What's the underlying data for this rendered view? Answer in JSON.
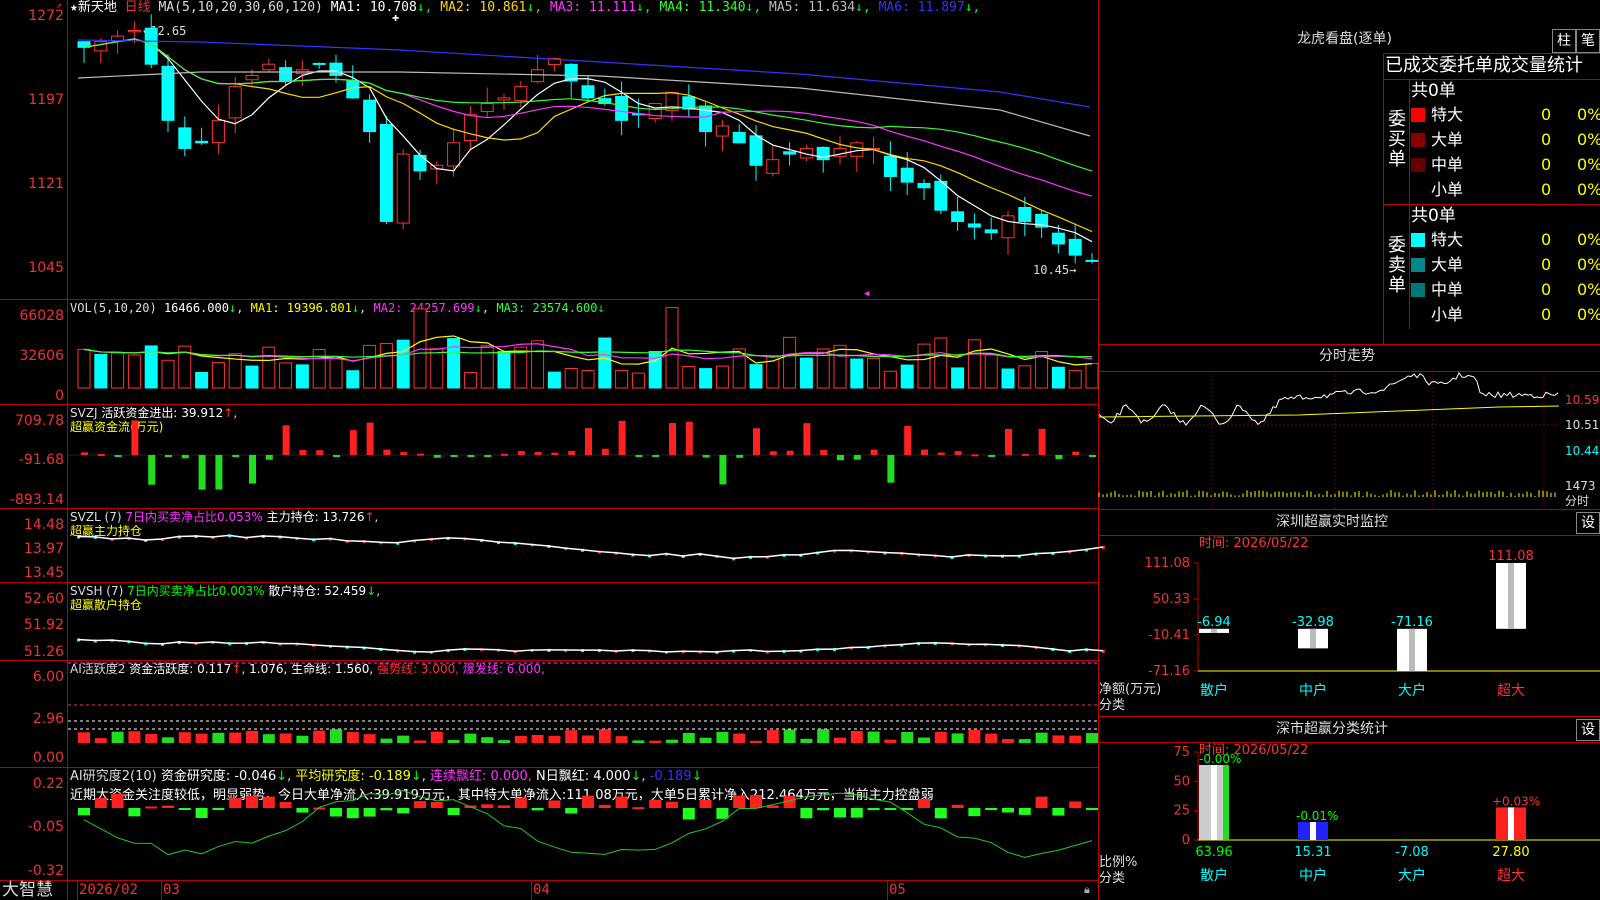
{
  "stock": {
    "star": "★",
    "name": "新天地",
    "period": "日线"
  },
  "main": {
    "ma_params": "MA(5,10,20,30,60,120)",
    "ma": [
      {
        "label": "MA1:",
        "value": "10.708",
        "dir": "↓",
        "color": "#ffffff"
      },
      {
        "label": "MA2:",
        "value": "10.861",
        "dir": "↓",
        "color": "#ffd700"
      },
      {
        "label": "MA3:",
        "value": "11.111",
        "dir": "↓",
        "color": "#ff33ff"
      },
      {
        "label": "MA4:",
        "value": "11.340",
        "dir": "↓",
        "color": "#33ff33"
      },
      {
        "label": "MA5:",
        "value": "11.634",
        "dir": "↓",
        "color": "#bbbbbb"
      },
      {
        "label": "MA6:",
        "value": "11.897",
        "dir": "↓",
        "color": "#3333ff"
      }
    ],
    "y_labels": [
      "1272",
      "1197",
      "1121",
      "1045"
    ],
    "high_note": "←12.65",
    "low_note": "10.45→"
  },
  "vol": {
    "title": "VOL(5,10,20)",
    "value": "16466.000",
    "dir": "↓",
    "ma1": "MA1: 19396.801",
    "ma1_dir": "↓",
    "ma2": "MA2: 24257.699",
    "ma2_dir": "↓",
    "ma3": "MA3: 23574.600",
    "ma3_dir": "↓",
    "y_labels": [
      "66028",
      "32606",
      "0"
    ]
  },
  "svzj": {
    "title": "SVZJ",
    "label": "活跃资金进出: 39.912",
    "dir": "↑",
    "sub": "超赢资金流(万元)",
    "y_labels": [
      "709.78",
      "-91.68",
      "-893.14"
    ]
  },
  "svzl": {
    "title": "SVZL (7)",
    "ratio": "7日内买卖净占比0.053%",
    "hold": "主力持仓: 13.726",
    "dir": "↑",
    "sub": "超赢主力持仓",
    "y_labels": [
      "14.48",
      "13.97",
      "13.45"
    ]
  },
  "svsh": {
    "title": "SVSH (7)",
    "ratio": "7日内买卖净占比0.003%",
    "hold": "散户持仓: 52.459",
    "dir": "↓",
    "sub": "超赢散户持仓",
    "y_labels": [
      "52.60",
      "51.92",
      "51.26"
    ]
  },
  "ai1": {
    "title": "AI活跃度2",
    "fund": "资金活跃度: 0.117",
    "v2": "1.076,",
    "life": "生命线: 1.560,",
    "strong": "强势线: 3.000,",
    "burst": "爆发线: 6.000,",
    "y_labels": [
      "6.00",
      "2.96",
      "0.00"
    ]
  },
  "ai2": {
    "title": "AI研究度2(10)",
    "fund": "资金研究度: -0.046",
    "avg": "平均研究度: -0.189",
    "cont": "连续飘红: 0.000,",
    "n": "N日飘红: 4.000",
    "last": "-0.189",
    "desc": "近期大资金关注度较低，明显弱势，今日大单净流入:39.919万元，其中特大单净流入:111.08万元，大单5日累计净入212.464万元，当前主力控盘弱",
    "y_labels": [
      "0.22",
      "-0.05",
      "-0.32"
    ]
  },
  "xaxis": {
    "brand": "大智慧",
    "labels": [
      "2026/02",
      "03",
      "04",
      "05"
    ]
  },
  "right": {
    "lhb": {
      "title": "龙虎看盘(逐单)",
      "btn1": "柱",
      "btn2": "笔",
      "header": "已成交委托单成交量统计",
      "buy": {
        "side": "委买单",
        "total": "共0单",
        "rows": [
          {
            "name": "特大",
            "qty": "0",
            "pct": "0%",
            "color": "#ff0000"
          },
          {
            "name": "大单",
            "qty": "0",
            "pct": "0%",
            "color": "#880000"
          },
          {
            "name": "中单",
            "qty": "0",
            "pct": "0%",
            "color": "#660000"
          },
          {
            "name": "小单",
            "qty": "0",
            "pct": "0%",
            "color": "#000000"
          }
        ]
      },
      "sell": {
        "side": "委卖单",
        "total": "共0单",
        "rows": [
          {
            "name": "特大",
            "qty": "0",
            "pct": "0%",
            "color": "#00ffff"
          },
          {
            "name": "大单",
            "qty": "0",
            "pct": "0%",
            "color": "#008888"
          },
          {
            "name": "中单",
            "qty": "0",
            "pct": "0%",
            "color": "#007777"
          },
          {
            "name": "小单",
            "qty": "0",
            "pct": "0%",
            "color": "#000000"
          }
        ]
      }
    },
    "fs": {
      "title": "分时走势",
      "y_labels": [
        "10.59",
        "10.51",
        "10.44"
      ],
      "vol_label": "1473",
      "vol_unit": "分时"
    },
    "sz": {
      "title": "深圳超赢实时监控",
      "btn": "设",
      "time": "时间: 2026/05/22",
      "y_labels": [
        "111.08",
        "50.33",
        "-10.41",
        "-71.16"
      ],
      "ylabel": "净额(万元)",
      "xlabel": "分类",
      "cats": [
        "散户",
        "中户",
        "大户",
        "超大"
      ],
      "values": [
        "-6.94",
        "-32.98",
        "-71.16",
        "111.08"
      ]
    },
    "fl": {
      "title": "深市超赢分类统计",
      "btn": "设",
      "time": "时间: 2026/05/22",
      "y_labels": [
        "75",
        "50",
        "25",
        "0"
      ],
      "ylabel": "比例%",
      "xlabel": "分类",
      "cats": [
        "散户",
        "中户",
        "大户",
        "超大"
      ],
      "top": [
        "-0.00%",
        "-0.01%",
        "",
        "+0.03%"
      ],
      "bottom": [
        "63.96",
        "15.31",
        "-7.08",
        "27.80"
      ]
    }
  }
}
